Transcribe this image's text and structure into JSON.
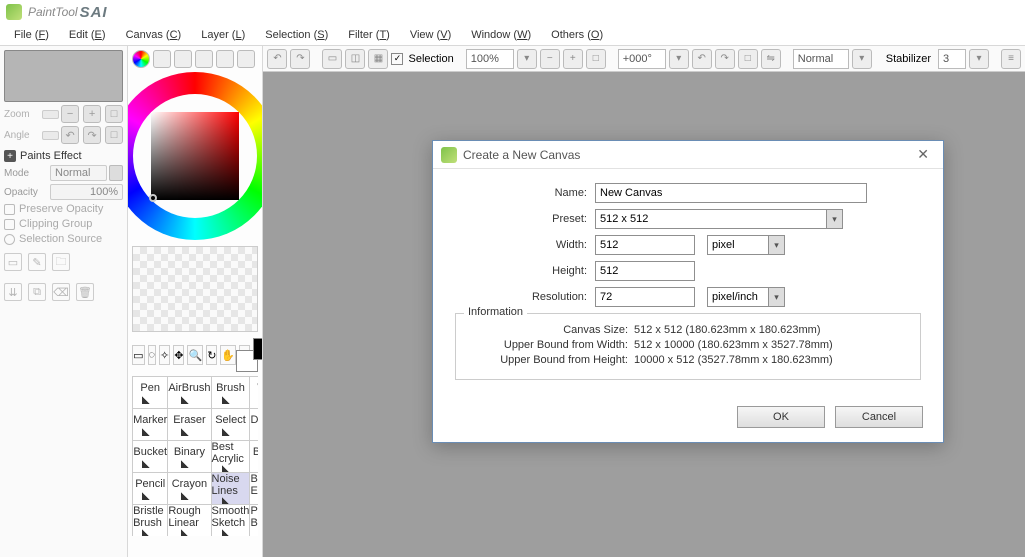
{
  "titlebar": {
    "app_name": "PaintTool",
    "suffix": "SAI"
  },
  "menu": {
    "items": [
      {
        "label": "File",
        "key": "F"
      },
      {
        "label": "Edit",
        "key": "E"
      },
      {
        "label": "Canvas",
        "key": "C"
      },
      {
        "label": "Layer",
        "key": "L"
      },
      {
        "label": "Selection",
        "key": "S"
      },
      {
        "label": "Filter",
        "key": "T"
      },
      {
        "label": "View",
        "key": "V"
      },
      {
        "label": "Window",
        "key": "W"
      },
      {
        "label": "Others",
        "key": "O"
      }
    ]
  },
  "left": {
    "zoom_label": "Zoom",
    "angle_label": "Angle",
    "paints_effect": "Paints Effect",
    "mode_label": "Mode",
    "mode_value": "Normal",
    "opacity_label": "Opacity",
    "opacity_value": "100%",
    "preserve": "Preserve Opacity",
    "clipping": "Clipping Group",
    "selsrc": "Selection Source"
  },
  "brushes": [
    "Pen",
    "AirBrush",
    "Brush",
    "Water",
    "Marker",
    "Eraser",
    "Select",
    "Deselect",
    "Bucket",
    "Binary",
    "Best Acrylic",
    "Blender",
    "Pencil",
    "Crayon",
    "Noise Lines",
    "Binary Eraser",
    "Bristle Brush",
    "Rough Linear",
    "Smooth Sketch",
    "Pencil Brush"
  ],
  "brush_selected_index": 14,
  "toolbar": {
    "selection_label": "Selection",
    "zoom": "100%",
    "rotation": "+000°",
    "blend": "Normal",
    "stabilizer_label": "Stabilizer",
    "stabilizer_value": "3"
  },
  "dialog": {
    "title": "Create a New Canvas",
    "labels": {
      "name": "Name:",
      "preset": "Preset:",
      "width": "Width:",
      "height": "Height:",
      "resolution": "Resolution:",
      "information": "Information",
      "canvas_size": "Canvas Size:",
      "ubw": "Upper Bound from Width:",
      "ubh": "Upper Bound from Height:"
    },
    "values": {
      "name": "New Canvas",
      "preset": " 512 x  512",
      "width": "512",
      "height": "512",
      "resolution": "72",
      "size_unit": "pixel",
      "res_unit": "pixel/inch",
      "canvas_size": "512 x 512 (180.623mm x 180.623mm)",
      "ubw": "512 x 10000 (180.623mm x 3527.78mm)",
      "ubh": "10000 x 512 (3527.78mm x 180.623mm)"
    },
    "buttons": {
      "ok": "OK",
      "cancel": "Cancel"
    }
  }
}
